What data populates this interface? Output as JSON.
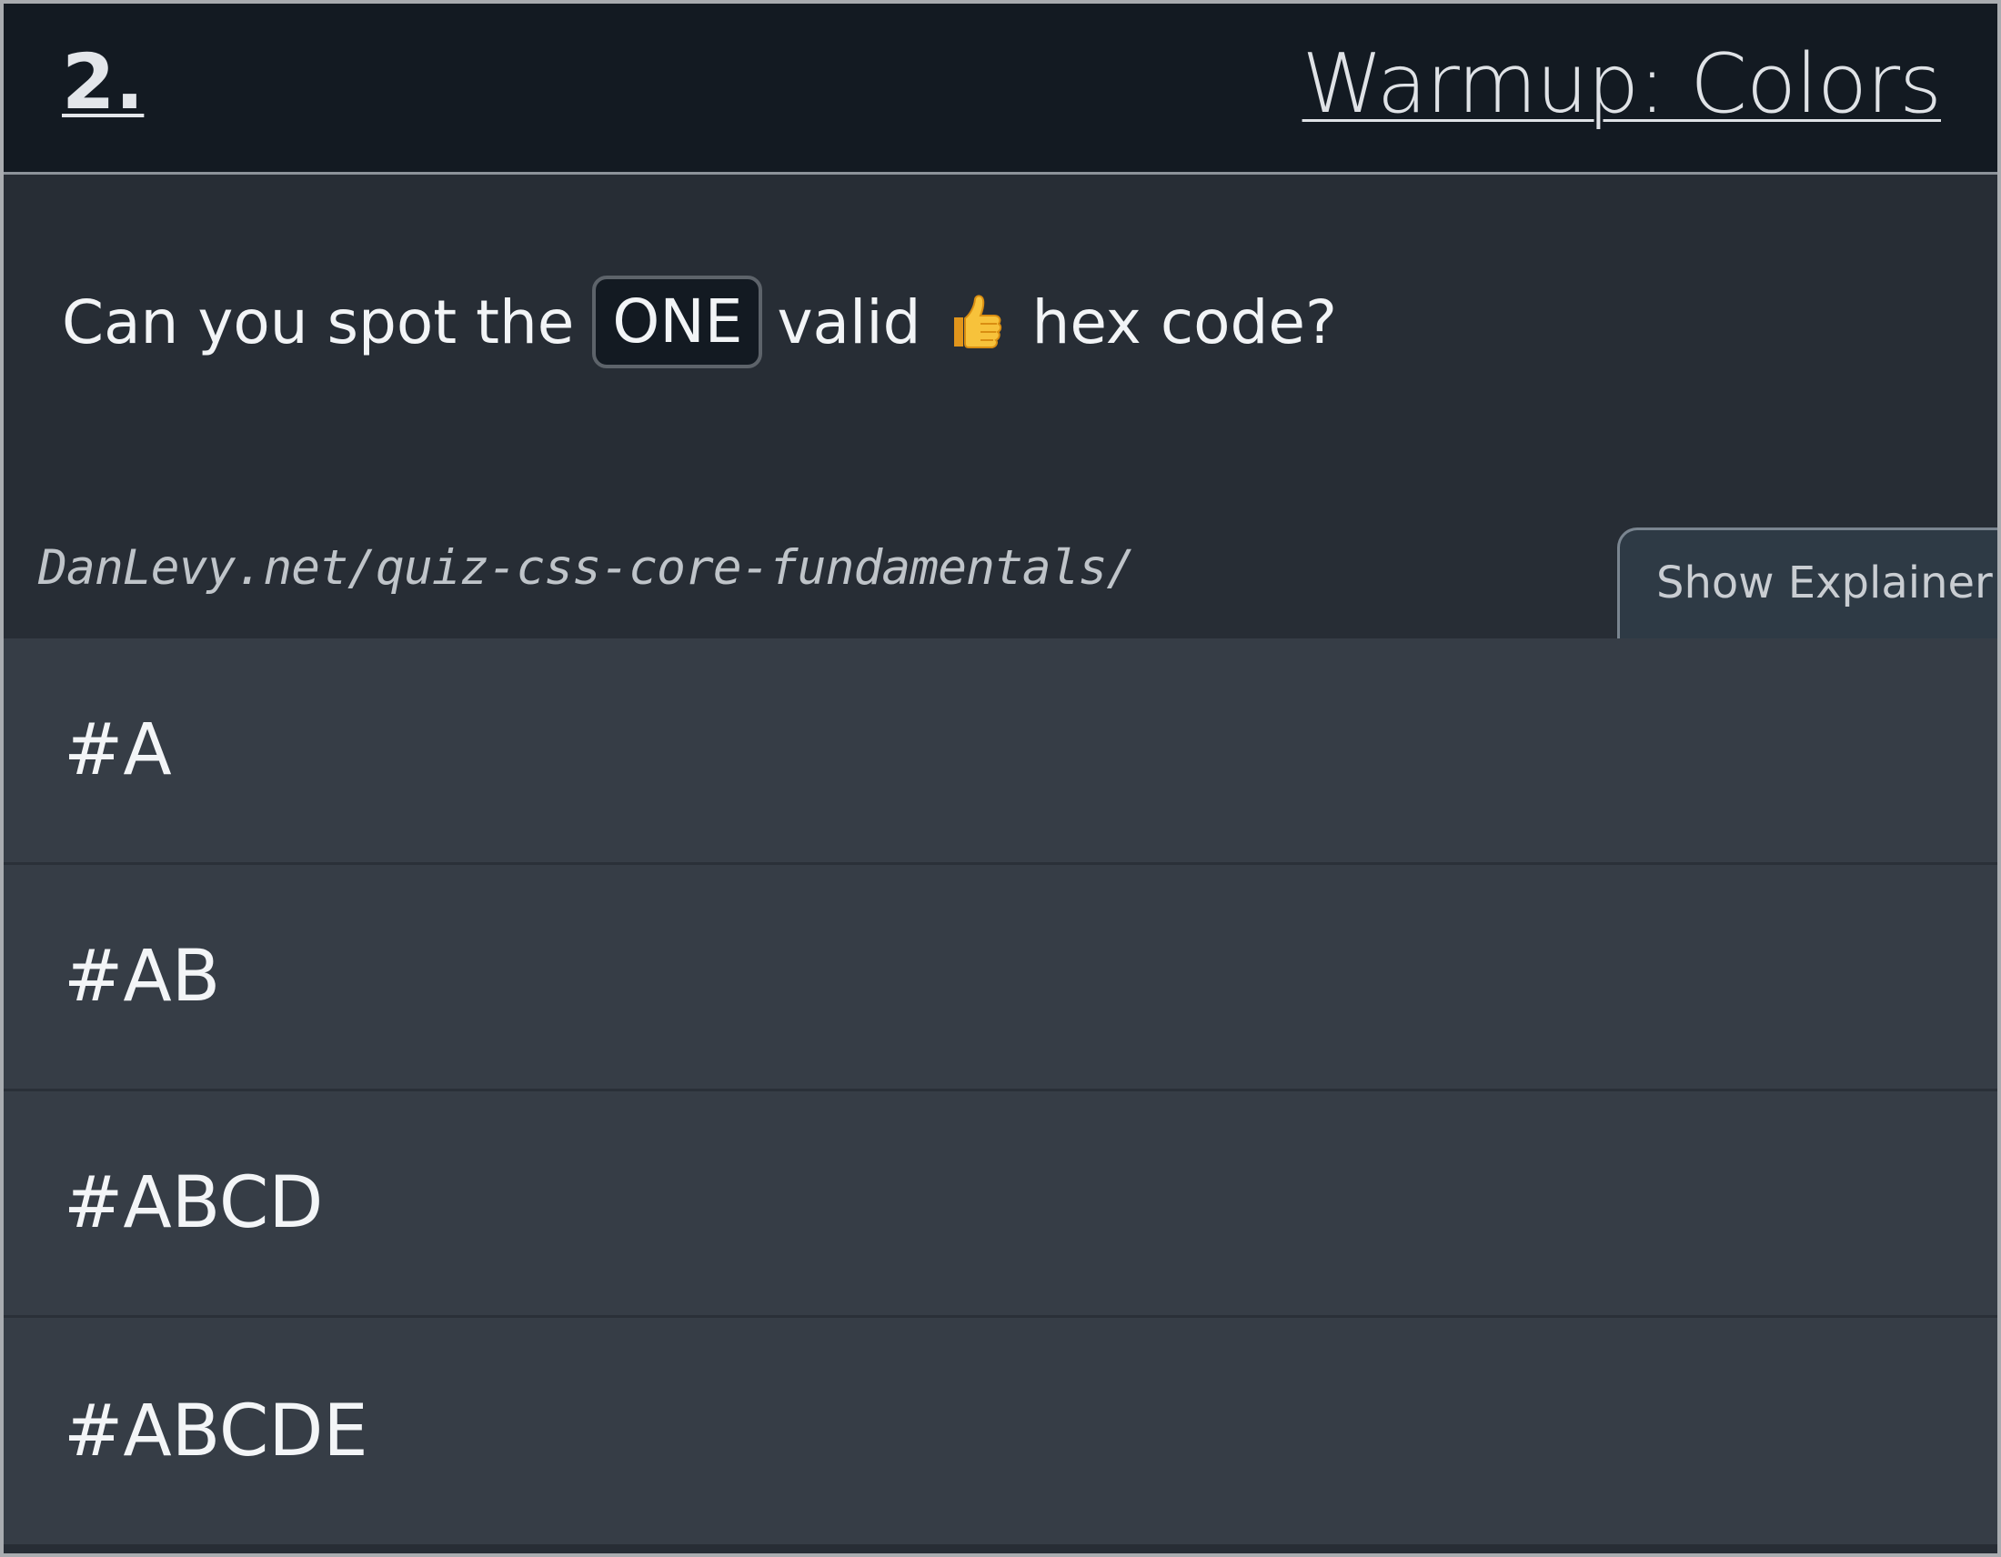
{
  "header": {
    "number": "2.",
    "title": "Warmup: Colors"
  },
  "prompt": {
    "before": "Can you spot the",
    "emphasis": "ONE",
    "after_emphasis": "valid",
    "emoji_icon": "thumbs-up-icon",
    "end": "hex code?"
  },
  "source_url": "DanLevy.net/quiz-css-core-fundamentals/",
  "explainer_button": "Show Explainer",
  "options": [
    {
      "label": "#A"
    },
    {
      "label": "#AB"
    },
    {
      "label": "#ABCD"
    },
    {
      "label": "#ABCDE"
    }
  ],
  "colors": {
    "header_bg": "#131a22",
    "body_bg": "#272d35",
    "option_bg": "#363d46",
    "text": "#f2f4f6",
    "button_bg": "#2e3a45"
  }
}
